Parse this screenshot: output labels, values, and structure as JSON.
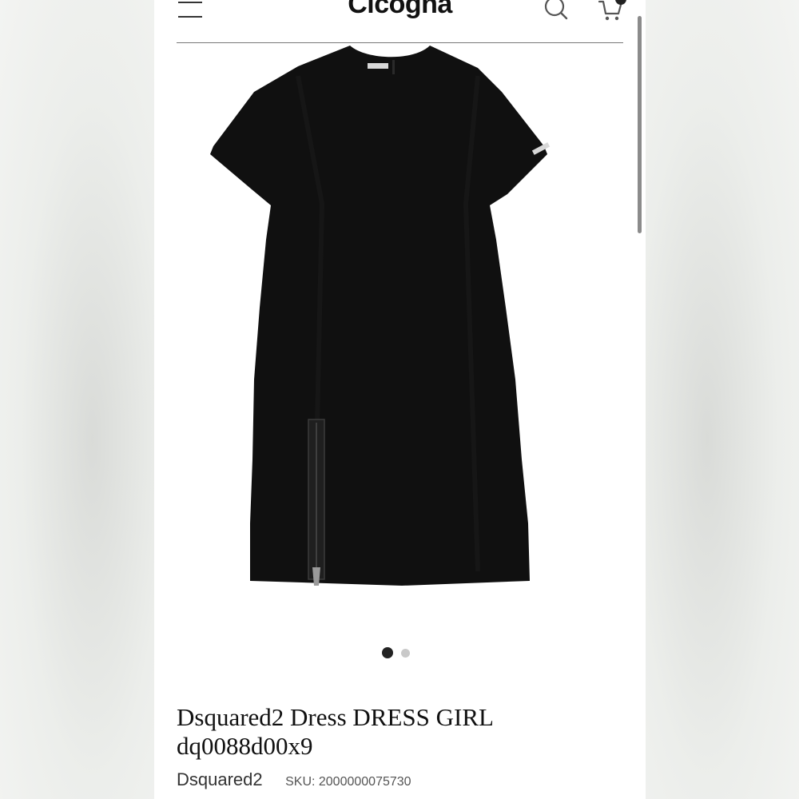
{
  "header": {
    "logo": "Cicogna",
    "menu_icon": "hamburger-menu-icon",
    "search_icon": "search-icon",
    "cart_icon": "shopping-cart-icon"
  },
  "product": {
    "image_alt": "dress-photo",
    "title": "Dsquared2 Dress DRESS GIRL dq0088d00x9",
    "brand": "Dsquared2",
    "sku": "SKU: 2000000075730"
  },
  "carousel": {
    "total": 2,
    "active": 1
  },
  "colors": {
    "text": "#111111",
    "dot_active": "#222222",
    "dot_inactive": "#c9c9c9"
  }
}
